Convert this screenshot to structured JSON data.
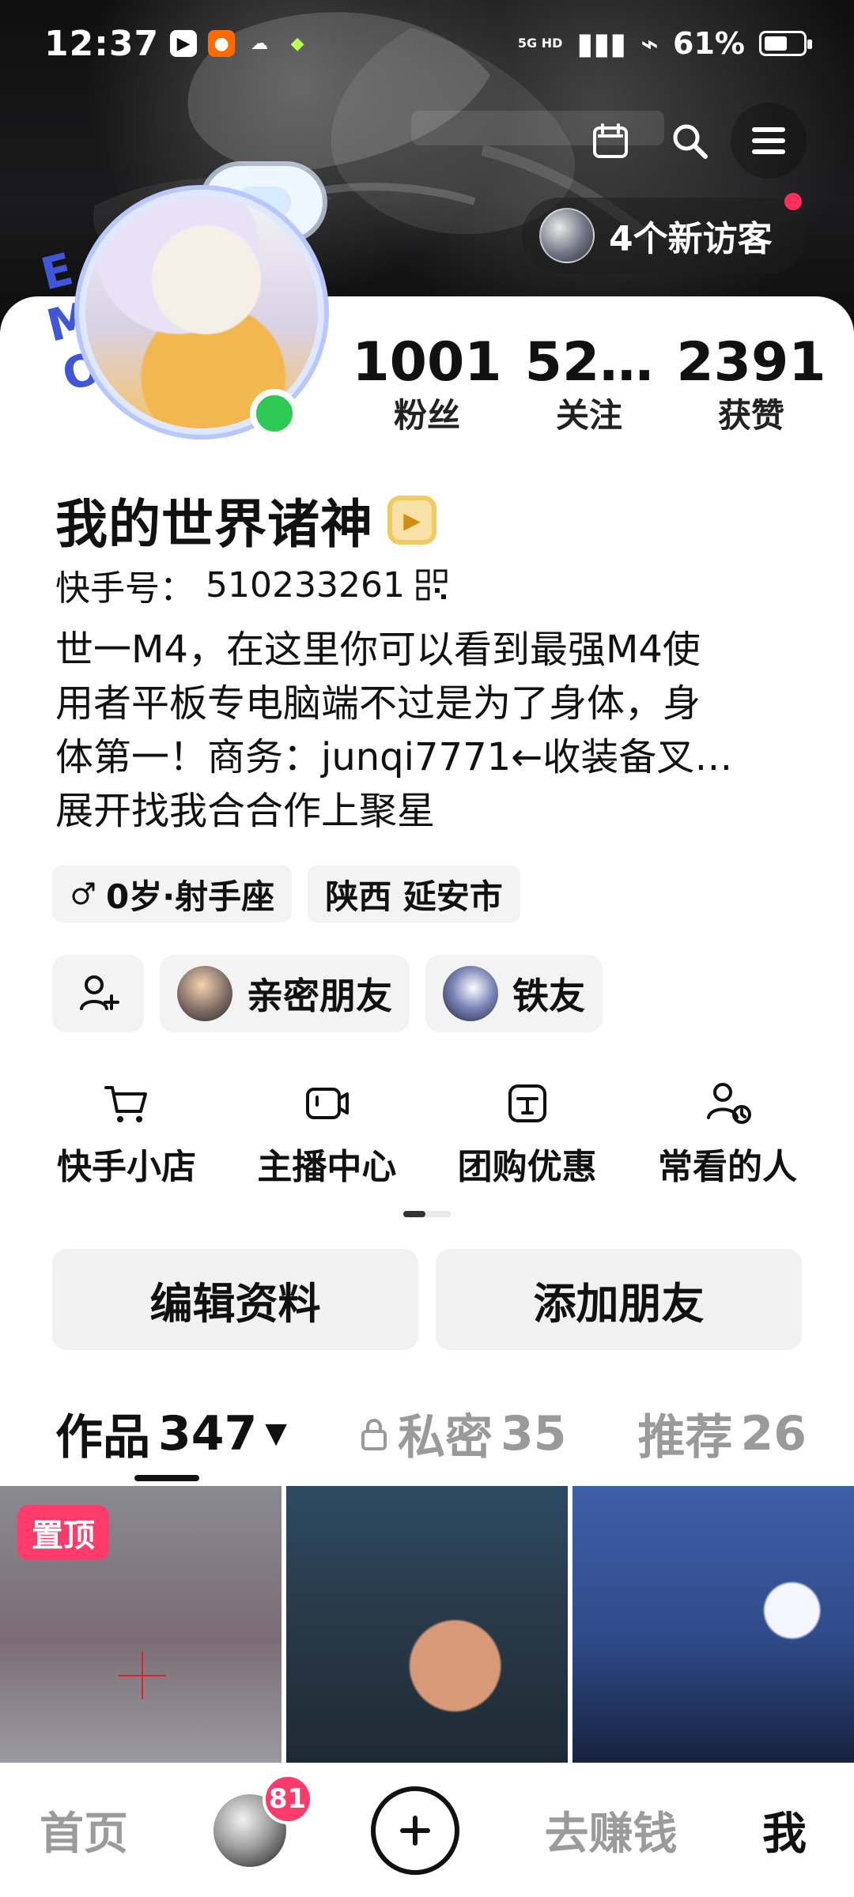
{
  "status_bar": {
    "time": "12:37",
    "network": "5G HD",
    "battery": "61%",
    "icons": [
      "play-icon",
      "app-icon",
      "cloud-icon",
      "game-icon",
      "signal-icon",
      "wifi-icon",
      "battery-icon"
    ]
  },
  "header": {
    "banner_icons": [
      "calendar-icon",
      "search-icon",
      "menu-icon"
    ],
    "new_visitors": "4个新访客"
  },
  "profile": {
    "emo_badge": "EMO",
    "stats": [
      {
        "value": "1001",
        "label": "粉丝"
      },
      {
        "value": "52…",
        "label": "关注"
      },
      {
        "value": "2391",
        "label": "获赞"
      }
    ],
    "name": "我的世界诸神",
    "id_label": "快手号：",
    "id_value": "510233261",
    "bio_lines": [
      "世一M4，在这里你可以看到最强M4使",
      "用者平板专电脑端不过是为了身体，身",
      "体第一！商务：junqi7771←收装备叉…",
      "展开找我合合作上聚星"
    ],
    "tags": {
      "age_sign": "0岁·射手座",
      "location": "陕西 延安市"
    },
    "friends": [
      "亲密朋友",
      "铁友"
    ]
  },
  "quick_actions": [
    {
      "label": "快手小店",
      "icon": "cart-icon"
    },
    {
      "label": "主播中心",
      "icon": "camera-icon"
    },
    {
      "label": "团购优惠",
      "icon": "coupon-icon"
    },
    {
      "label": "常看的人",
      "icon": "person-clock-icon"
    }
  ],
  "buttons": {
    "edit_profile": "编辑资料",
    "add_friend": "添加朋友"
  },
  "tabs": [
    {
      "label": "作品",
      "count": "347",
      "active": true
    },
    {
      "label": "私密",
      "count": "35",
      "active": false
    },
    {
      "label": "推荐",
      "count": "26",
      "active": false
    }
  ],
  "grid": {
    "pinned_label": "置顶"
  },
  "bottom_nav": {
    "home": "首页",
    "notification_count": "81",
    "earn": "去赚钱",
    "me": "我"
  },
  "colors": {
    "accent_red": "#ff3b6b",
    "online_green": "#2fca55",
    "chip_bg": "#f3f3f3"
  }
}
